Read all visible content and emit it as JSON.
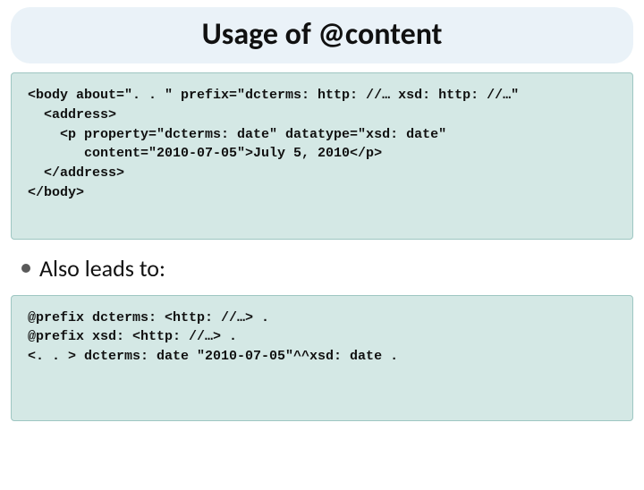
{
  "title": "Usage of @content",
  "code1": "<body about=\". . \" prefix=\"dcterms: http: //… xsd: http: //…\"\n  <address>\n    <p property=\"dcterms: date\" datatype=\"xsd: date\"\n       content=\"2010-07-05\">July 5, 2010</p>\n  </address>\n</body>",
  "bullet": "Also leads to:",
  "code2": "@prefix dcterms: <http: //…> .\n@prefix xsd: <http: //…> .\n<. . > dcterms: date \"2010-07-05\"^^xsd: date ."
}
